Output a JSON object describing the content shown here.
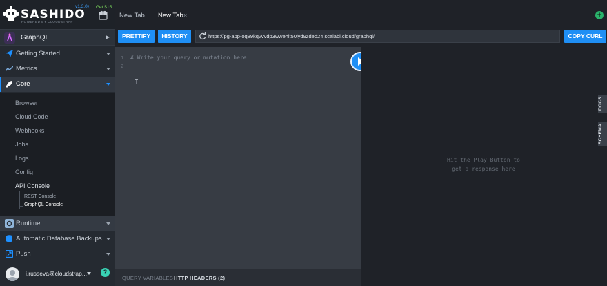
{
  "brand": {
    "name": "SASHIDO",
    "subtitle": "POWERED BY CLOUDSTRAP",
    "version": "v1.3.0+",
    "promo": "Get $15"
  },
  "app_selector": {
    "label": "GraphQL"
  },
  "nav": {
    "getting_started": "Getting Started",
    "metrics": "Metrics",
    "core": "Core",
    "runtime": "Runtime",
    "backups": "Automatic Database Backups",
    "push": "Push"
  },
  "core_menu": {
    "browser": "Browser",
    "cloud_code": "Cloud Code",
    "webhooks": "Webhooks",
    "jobs": "Jobs",
    "logs": "Logs",
    "config": "Config",
    "api_console": "API Console",
    "rest_console": "REST Console",
    "graphql_console": "GraphQL Console"
  },
  "user": {
    "email": "i.russeva@cloudstrap...",
    "help": "?"
  },
  "tabs": {
    "first": "New Tab",
    "second": "New Tab",
    "close": "×",
    "add": "+"
  },
  "toolbar": {
    "prettify": "PRETTIFY",
    "history": "HISTORY",
    "url": "https://pg-app-oq89kqvvvdp3wwehlt50iyd9zded24.scalabl.cloud/graphql/",
    "copy_curl": "COPY CURL"
  },
  "editor": {
    "line1": "1",
    "line2": "2",
    "placeholder": "# Write your query or mutation here",
    "cursor": "I"
  },
  "bottom_tabs": {
    "query_variables": "QUERY VARIABLES",
    "http_headers": "HTTP HEADERS (2)"
  },
  "result": {
    "line1": "Hit the Play Button to",
    "line2": "get a response here"
  },
  "side_tabs": {
    "docs": "DOCS",
    "schema": "SCHEMA"
  },
  "colors": {
    "accent": "#1f8ff5",
    "sidebar": "#252a31",
    "editor": "#373c44",
    "add_tab": "#2ab36b",
    "help": "#39d2b4"
  }
}
